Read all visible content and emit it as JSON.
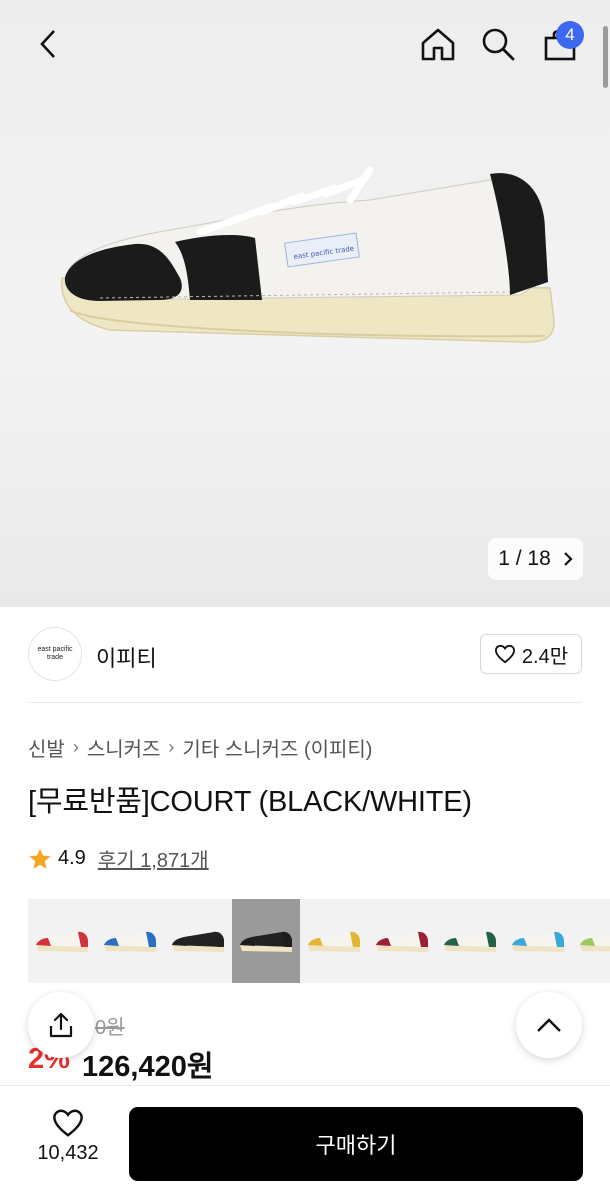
{
  "header": {
    "back_icon": "chevron-left-icon",
    "home_icon": "home-icon",
    "search_icon": "search-icon",
    "cart_icon": "shopping-bag-icon",
    "cart_count": "4",
    "badge_color": "#3d68f0"
  },
  "gallery": {
    "image": "product-photo-sneaker",
    "counter": "1 / 18",
    "next_icon": "chevron-right-icon"
  },
  "brand": {
    "logo_text": "east pacific trade",
    "name": "이피티",
    "likes": "2.4만",
    "like_icon": "heart-icon"
  },
  "breadcrumb": [
    "신발",
    "스니커즈",
    "기타 스니커즈 (이피티)"
  ],
  "product": {
    "title": "[무료반품]COURT (BLACK/WHITE)"
  },
  "rating": {
    "score": "4.9",
    "reviews": "후기 1,871개",
    "star_color": "#f5a623"
  },
  "swatches": {
    "selected_index": 3,
    "colors": [
      "#d1323b",
      "#2a6fc0",
      "#222222",
      "#1d1d1d",
      "#e4b530",
      "#9b2035",
      "#22624a",
      "#39a7d8",
      "#9cc95b"
    ]
  },
  "price": {
    "original": "0원",
    "discount": "2%",
    "final": "126,420원",
    "discount_color": "#e8302b"
  },
  "bottom": {
    "wish_count": "10,432",
    "buy_label": "구매하기"
  }
}
